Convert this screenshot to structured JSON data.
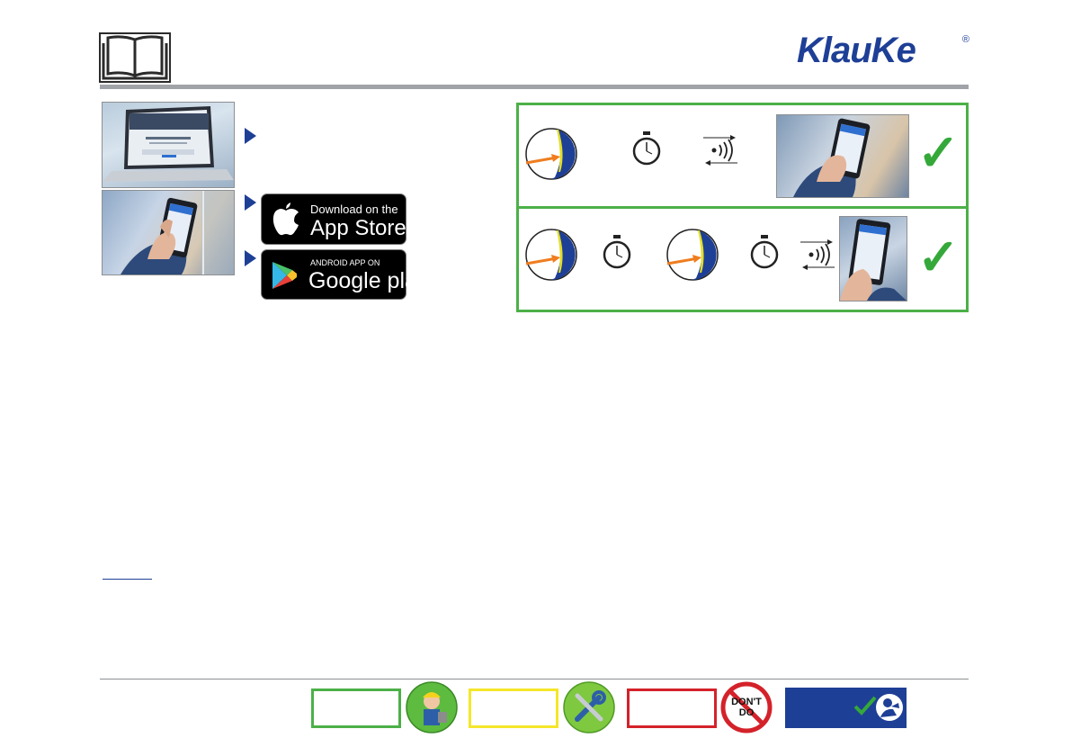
{
  "header": {
    "manual_icon": "open-book-icon",
    "logo_text": "KlauKe",
    "logo_registered": "®"
  },
  "left_panel": {
    "laptop_photo": "laptop-website-photo",
    "phone_photo": "hand-holding-smartphone-photo",
    "app_store": {
      "small": "Download on the",
      "big": "App Store",
      "icon": "apple-icon"
    },
    "google_play": {
      "small": "ANDROID APP ON",
      "big": "Google play",
      "icon": "google-play-icon"
    }
  },
  "right_panel": {
    "row1": {
      "icons": [
        "gauge-icon",
        "stopwatch-icon",
        "bluetooth-transfer-icon",
        "smartphone-photo",
        "checkmark-icon"
      ],
      "tick": "✓"
    },
    "row2": {
      "icons": [
        "gauge-icon",
        "stopwatch-icon",
        "gauge-icon",
        "stopwatch-icon",
        "bluetooth-transfer-icon",
        "smartphone-photo",
        "checkmark-icon"
      ],
      "tick": "✓"
    }
  },
  "footer": {
    "dont_do_text": "DON'T DO",
    "colors": {
      "green": "#4cb048",
      "yellow": "#f4e62a",
      "red": "#d4222a",
      "blue": "#1e3f96"
    }
  }
}
